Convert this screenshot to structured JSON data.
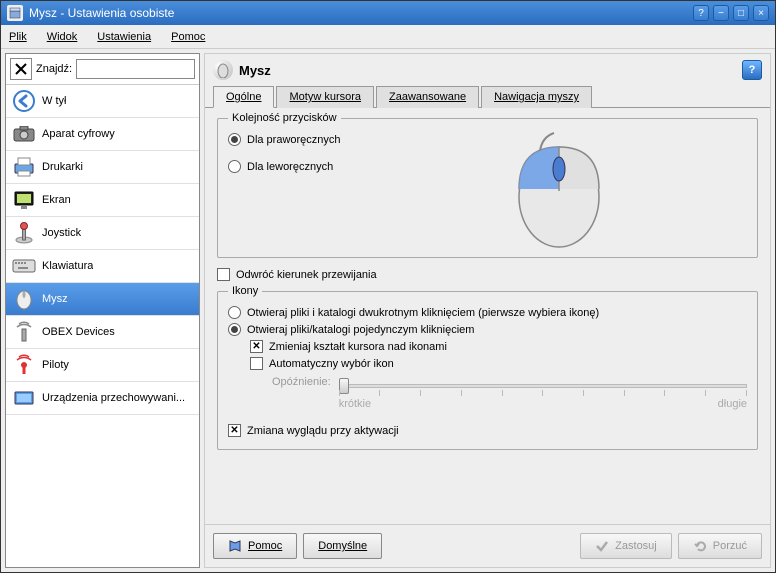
{
  "window": {
    "title": "Mysz - Ustawienia osobiste"
  },
  "menubar": {
    "file": "Plik",
    "view": "Widok",
    "settings": "Ustawienia",
    "help": "Pomoc"
  },
  "sidebar": {
    "search_label": "Znajdź:",
    "search_value": "",
    "items": [
      {
        "label": "W tył",
        "icon": "back-icon"
      },
      {
        "label": "Aparat cyfrowy",
        "icon": "camera-icon"
      },
      {
        "label": "Drukarki",
        "icon": "printer-icon"
      },
      {
        "label": "Ekran",
        "icon": "display-icon"
      },
      {
        "label": "Joystick",
        "icon": "joystick-icon"
      },
      {
        "label": "Klawiatura",
        "icon": "keyboard-icon"
      },
      {
        "label": "Mysz",
        "icon": "mouse-icon"
      },
      {
        "label": "OBEX Devices",
        "icon": "obex-icon"
      },
      {
        "label": "Piloty",
        "icon": "remote-icon"
      },
      {
        "label": "Urządzenia przechowywani...",
        "icon": "storage-icon"
      }
    ]
  },
  "panel": {
    "title": "Mysz",
    "tabs": {
      "general": "Ogólne",
      "cursor_theme": "Motyw kursora",
      "advanced": "Zaawansowane",
      "mouse_nav": "Nawigacja myszy"
    },
    "button_order": {
      "legend": "Kolejność przycisków",
      "right_handed": "Dla praworęcznych",
      "left_handed": "Dla leworęcznych"
    },
    "reverse_scroll": "Odwróć kierunek przewijania",
    "icons": {
      "legend": "Ikony",
      "double_click_open": "Otwieraj pliki i katalogi dwukrotnym kliknięciem (pierwsze wybiera ikonę)",
      "single_click_open": "Otwieraj pliki/katalogi pojedynczym kliknięciem",
      "change_cursor": "Zmieniaj kształt kursora nad ikonami",
      "auto_select": "Automatyczny wybór ikon",
      "delay_label": "Opóźnienie:",
      "delay_short": "krótkie",
      "delay_long": "długie",
      "change_look_activate": "Zmiana wyglądu przy aktywacji"
    }
  },
  "footer": {
    "help": "Pomoc",
    "defaults": "Domyślne",
    "apply": "Zastosuj",
    "reset": "Porzuć"
  }
}
